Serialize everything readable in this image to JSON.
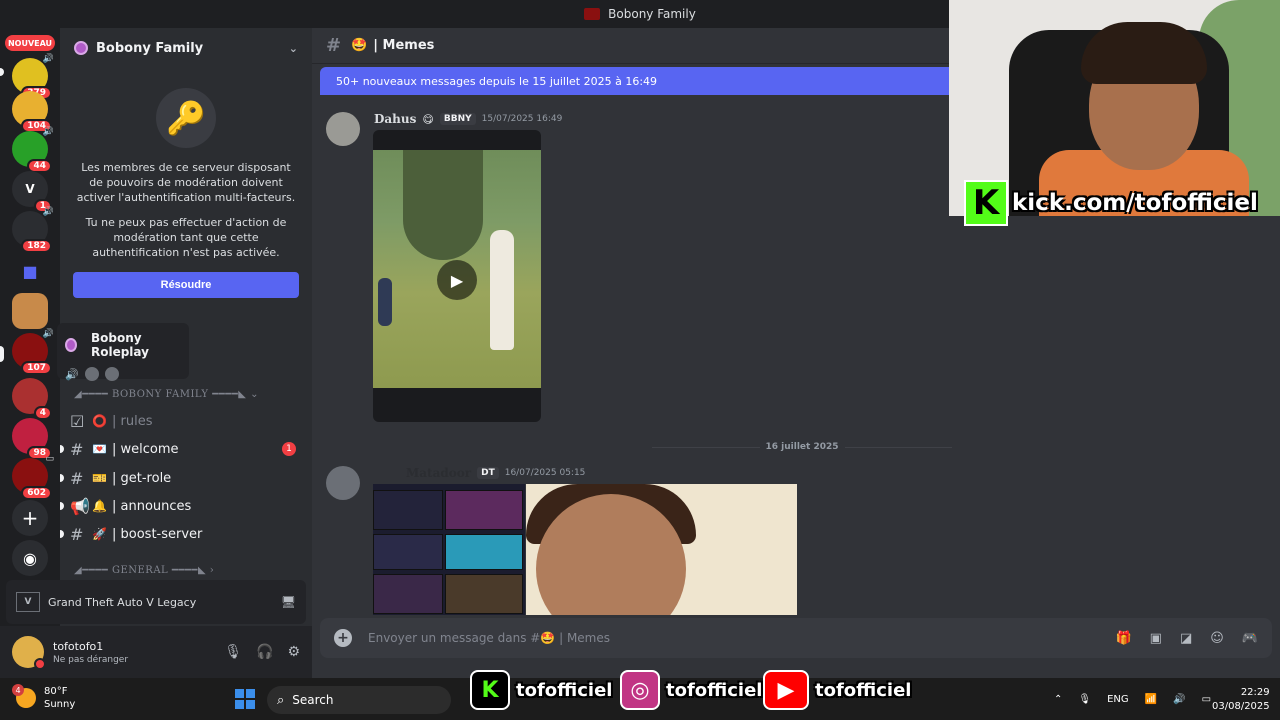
{
  "window": {
    "title": "Bobony Family"
  },
  "rail": {
    "new_label": "NOUVEAU",
    "servers": [
      {
        "badge": "379",
        "color": "#e0c020",
        "text": ""
      },
      {
        "badge": "104",
        "color": "#e8b030",
        "text": ""
      },
      {
        "badge": "44",
        "color": "#28a028",
        "text": ""
      },
      {
        "badge": "1",
        "color": "#2b2d31",
        "text": "V"
      },
      {
        "badge": "182",
        "color": "#2b2d31",
        "text": ""
      },
      {
        "badge": "",
        "color": "#5865f2",
        "text": ""
      },
      {
        "badge": "",
        "color": "#c88a4a",
        "text": ""
      },
      {
        "badge": "107",
        "color": "#8a1010",
        "text": ""
      },
      {
        "badge": "4",
        "color": "#aa3030",
        "text": ""
      },
      {
        "badge": "98",
        "color": "#c02040",
        "text": ""
      },
      {
        "badge": "602",
        "color": "#8a1010",
        "text": ""
      }
    ],
    "add_icon": "+",
    "discover_icon": "◉"
  },
  "sidebar": {
    "guild_name": "Bobony Family",
    "mfa_text_1": "Les membres de ce serveur disposant de pouvoirs de modération doivent activer l'authentification multi-facteurs.",
    "mfa_text_2": "Tu ne peux pas effectuer d'action de modération tant que cette authentification n'est pas activée.",
    "resolve_label": "Résoudre",
    "popup_title": "Bobony Roleplay",
    "category_1": "◢━━━━ BOBONY FAMILY ━━━━◣ ⌄",
    "category_2": "◢━━━━ GENERAL ━━━━◣ ›",
    "channels": [
      {
        "emoji": "⭕",
        "name": "| rules",
        "unread": ""
      },
      {
        "emoji": "💌",
        "name": "| welcome",
        "unread": "1"
      },
      {
        "emoji": "🎫",
        "name": "| get-role",
        "unread": ""
      },
      {
        "emoji": "🔔",
        "name": "| announces",
        "unread": ""
      },
      {
        "emoji": "🚀",
        "name": "| boost-server",
        "unread": ""
      }
    ],
    "activity": "Grand Theft Auto V Legacy",
    "user": {
      "name": "tofotofo1",
      "status": "Ne pas déranger"
    }
  },
  "chat": {
    "channel_emoji": "🤩",
    "channel_name": "| Memes",
    "banner": "50+ nouveaux messages depuis le 15 juillet 2025 à 16:49",
    "messages": [
      {
        "author": "Dahus",
        "tag": "BBNY",
        "time": "15/07/2025 16:49"
      },
      {
        "author": "Matadoor",
        "tag": "DT",
        "time": "16/07/2025 05:15"
      }
    ],
    "date_divider": "16 juillet 2025",
    "composer_placeholder": "Envoyer un message dans #🤩 | Memes"
  },
  "stream_overlay": {
    "kick_url": "kick.com/tofofficiel",
    "handle": "tofofficiel"
  },
  "taskbar": {
    "temp": "80°F",
    "weather": "Sunny",
    "weather_badge": "4",
    "search": "Search",
    "lang": "ENG",
    "time": "22:29",
    "date": "03/08/2025"
  }
}
